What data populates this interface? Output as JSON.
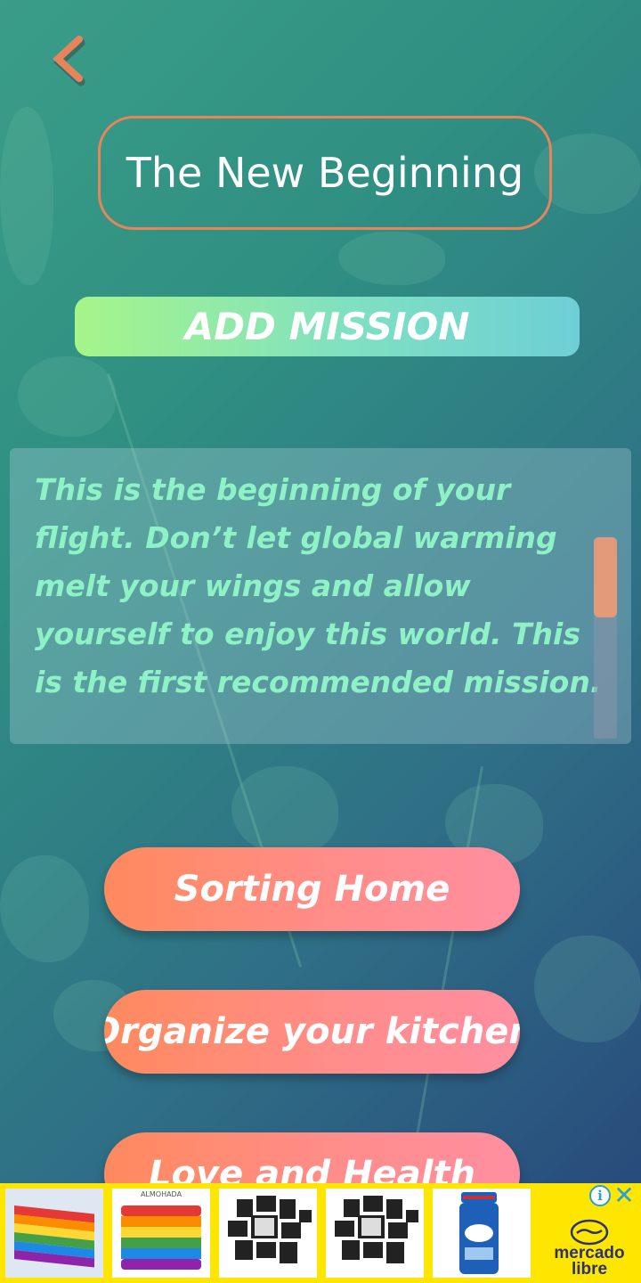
{
  "header": {
    "back_icon": "chevron-left-icon",
    "title": "The New Beginning"
  },
  "actions": {
    "add_mission_label": "ADD MISSION"
  },
  "description": {
    "text": "This is the beginning of your flight. Don’t let global warming melt your wings and allow yourself to enjoy this world. This is the first recommended mission."
  },
  "missions": [
    {
      "label": "Sorting Home"
    },
    {
      "label": "Organize your kitchen"
    },
    {
      "label": "Love and Health"
    }
  ],
  "ad": {
    "thumb_text": "ALMOHADA",
    "brand_line1": "mercado",
    "brand_line2": "libre",
    "info_icon": "info-icon",
    "close_icon": "close-icon"
  },
  "colors": {
    "accent_orange": "#e8845c",
    "text_mint": "#8ff2c6",
    "ad_yellow": "#ffe600"
  }
}
